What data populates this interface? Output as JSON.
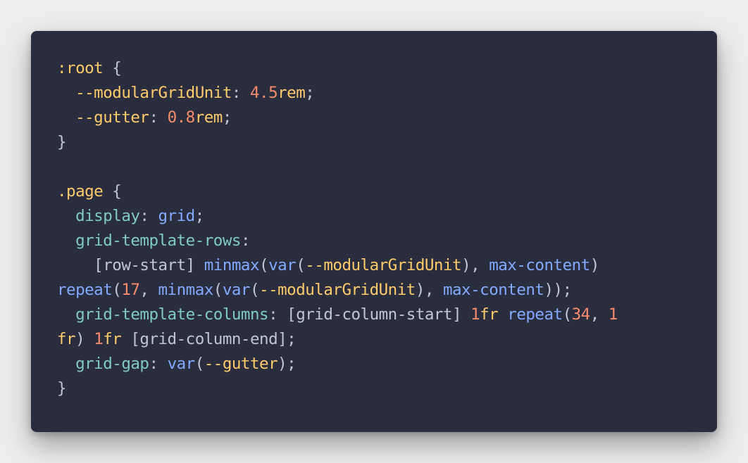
{
  "code_lines": [
    [
      {
        "text": ":root",
        "type": "selector"
      },
      {
        "text": " {",
        "type": "punct"
      }
    ],
    [
      {
        "text": "  ",
        "type": "plain"
      },
      {
        "text": "--modularGridUnit",
        "type": "varname"
      },
      {
        "text": ": ",
        "type": "punct"
      },
      {
        "text": "4.5",
        "type": "number"
      },
      {
        "text": "rem",
        "type": "unit"
      },
      {
        "text": ";",
        "type": "punct"
      }
    ],
    [
      {
        "text": "  ",
        "type": "plain"
      },
      {
        "text": "--gutter",
        "type": "varname"
      },
      {
        "text": ": ",
        "type": "punct"
      },
      {
        "text": "0.8",
        "type": "number"
      },
      {
        "text": "rem",
        "type": "unit"
      },
      {
        "text": ";",
        "type": "punct"
      }
    ],
    [
      {
        "text": "}",
        "type": "punct"
      }
    ],
    [],
    [
      {
        "text": ".page",
        "type": "selector"
      },
      {
        "text": " {",
        "type": "punct"
      }
    ],
    [
      {
        "text": "  ",
        "type": "plain"
      },
      {
        "text": "display",
        "type": "prop"
      },
      {
        "text": ": ",
        "type": "punct"
      },
      {
        "text": "grid",
        "type": "value"
      },
      {
        "text": ";",
        "type": "punct"
      }
    ],
    [
      {
        "text": "  ",
        "type": "plain"
      },
      {
        "text": "grid-template-rows",
        "type": "prop"
      },
      {
        "text": ":",
        "type": "punct"
      }
    ],
    [
      {
        "text": "    [row-start] ",
        "type": "plain"
      },
      {
        "text": "minmax",
        "type": "fn"
      },
      {
        "text": "(",
        "type": "punct"
      },
      {
        "text": "var",
        "type": "fn"
      },
      {
        "text": "(",
        "type": "punct"
      },
      {
        "text": "--modularGridUnit",
        "type": "varname"
      },
      {
        "text": "), ",
        "type": "punct"
      },
      {
        "text": "max-content",
        "type": "value"
      },
      {
        "text": ")",
        "type": "punct"
      }
    ],
    [
      {
        "text": "repeat",
        "type": "fn"
      },
      {
        "text": "(",
        "type": "punct"
      },
      {
        "text": "17",
        "type": "number"
      },
      {
        "text": ", ",
        "type": "punct"
      },
      {
        "text": "minmax",
        "type": "fn"
      },
      {
        "text": "(",
        "type": "punct"
      },
      {
        "text": "var",
        "type": "fn"
      },
      {
        "text": "(",
        "type": "punct"
      },
      {
        "text": "--modularGridUnit",
        "type": "varname"
      },
      {
        "text": "), ",
        "type": "punct"
      },
      {
        "text": "max-content",
        "type": "value"
      },
      {
        "text": "));",
        "type": "punct"
      }
    ],
    [
      {
        "text": "  ",
        "type": "plain"
      },
      {
        "text": "grid-template-columns",
        "type": "prop"
      },
      {
        "text": ": [grid-column-start] ",
        "type": "punct"
      },
      {
        "text": "1",
        "type": "number"
      },
      {
        "text": "fr",
        "type": "unit"
      },
      {
        "text": " ",
        "type": "plain"
      },
      {
        "text": "repeat",
        "type": "fn"
      },
      {
        "text": "(",
        "type": "punct"
      },
      {
        "text": "34",
        "type": "number"
      },
      {
        "text": ", ",
        "type": "punct"
      },
      {
        "text": "1",
        "type": "number"
      }
    ],
    [
      {
        "text": "fr",
        "type": "unit"
      },
      {
        "text": ") ",
        "type": "punct"
      },
      {
        "text": "1",
        "type": "number"
      },
      {
        "text": "fr",
        "type": "unit"
      },
      {
        "text": " [grid-column-end];",
        "type": "punct"
      }
    ],
    [
      {
        "text": "  ",
        "type": "plain"
      },
      {
        "text": "grid-gap",
        "type": "prop"
      },
      {
        "text": ": ",
        "type": "punct"
      },
      {
        "text": "var",
        "type": "fn"
      },
      {
        "text": "(",
        "type": "punct"
      },
      {
        "text": "--gutter",
        "type": "varname"
      },
      {
        "text": ");",
        "type": "punct"
      }
    ],
    [
      {
        "text": "}",
        "type": "punct"
      }
    ]
  ],
  "colors": {
    "background": "#292d3e",
    "selector": "#ffcb6b",
    "property": "#80cbc4",
    "function": "#82aaff",
    "number": "#f78c6c",
    "text": "#bfc7d5"
  }
}
